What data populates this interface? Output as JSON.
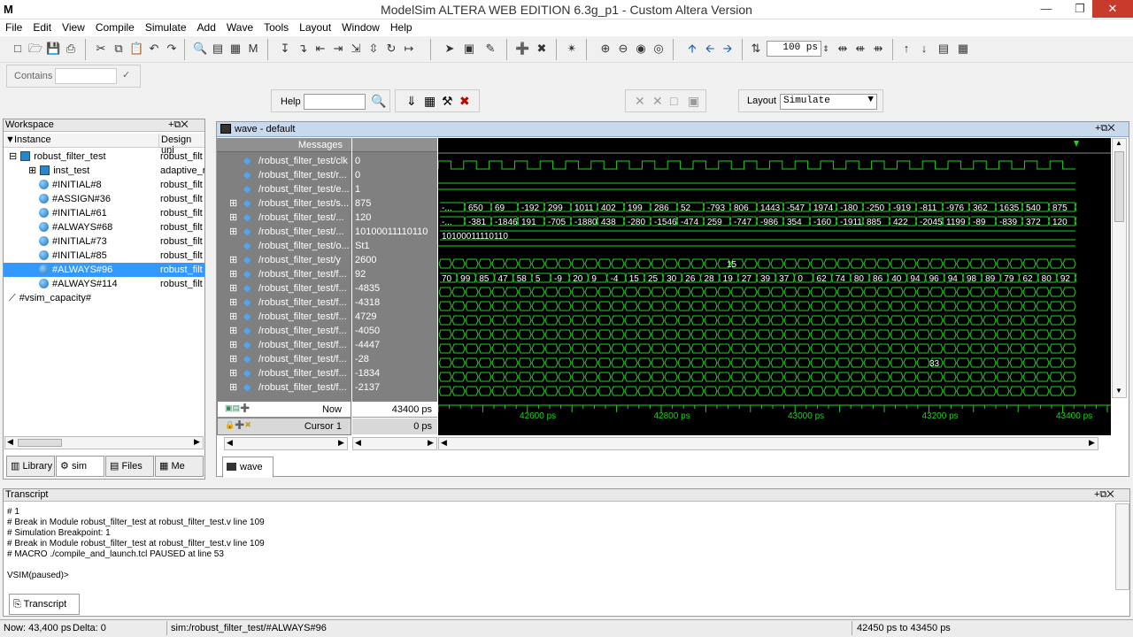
{
  "window": {
    "title": "ModelSim ALTERA WEB EDITION 6.3g_p1 - Custom Altera Version",
    "logo": "M"
  },
  "menu": [
    "File",
    "Edit",
    "View",
    "Compile",
    "Simulate",
    "Add",
    "Wave",
    "Tools",
    "Layout",
    "Window",
    "Help"
  ],
  "toolbar": {
    "zoom_value": "100 ps",
    "contains_label": "Contains",
    "help_label": "Help",
    "layout_label": "Layout",
    "layout_value": "Simulate"
  },
  "workspace": {
    "title": "Workspace",
    "col_instance": "Instance",
    "col_design": "Design uni",
    "rows": [
      {
        "name": "robust_filter_test",
        "design": "robust_filt",
        "icon": "cube-icon",
        "indent": 0,
        "expander": "-"
      },
      {
        "name": "inst_test",
        "design": "adaptive_r",
        "icon": "cube-icon",
        "indent": 1,
        "expander": "+"
      },
      {
        "name": "#INITIAL#8",
        "design": "robust_filt",
        "icon": "process-icon",
        "indent": 1,
        "expander": ""
      },
      {
        "name": "#ASSIGN#36",
        "design": "robust_filt",
        "icon": "process-icon",
        "indent": 1,
        "expander": ""
      },
      {
        "name": "#INITIAL#61",
        "design": "robust_filt",
        "icon": "process-icon",
        "indent": 1,
        "expander": ""
      },
      {
        "name": "#ALWAYS#68",
        "design": "robust_filt",
        "icon": "process-icon",
        "indent": 1,
        "expander": ""
      },
      {
        "name": "#INITIAL#73",
        "design": "robust_filt",
        "icon": "process-icon",
        "indent": 1,
        "expander": ""
      },
      {
        "name": "#INITIAL#85",
        "design": "robust_filt",
        "icon": "process-icon",
        "indent": 1,
        "expander": ""
      },
      {
        "name": "#ALWAYS#96",
        "design": "robust_filt",
        "icon": "process-icon",
        "indent": 1,
        "expander": "",
        "selected": true
      },
      {
        "name": "#ALWAYS#114",
        "design": "robust_filt",
        "icon": "process-icon",
        "indent": 1,
        "expander": ""
      },
      {
        "name": "#vsim_capacity#",
        "design": "",
        "icon": "capacity-icon",
        "indent": 0,
        "expander": ""
      }
    ],
    "tabs": [
      "Library",
      "sim",
      "Files",
      "Me"
    ]
  },
  "wave": {
    "title": "wave - default",
    "messages_label": "Messages",
    "signals": [
      {
        "name": "/robust_filter_test/clk",
        "value": "0",
        "exp": false
      },
      {
        "name": "/robust_filter_test/r...",
        "value": "0",
        "exp": false
      },
      {
        "name": "/robust_filter_test/e...",
        "value": "1",
        "exp": false
      },
      {
        "name": "/robust_filter_test/s...",
        "value": "875",
        "exp": true
      },
      {
        "name": "/robust_filter_test/...",
        "value": "120",
        "exp": true
      },
      {
        "name": "/robust_filter_test/...",
        "value": "10100011110110",
        "exp": true
      },
      {
        "name": "/robust_filter_test/o...",
        "value": "St1",
        "exp": false
      },
      {
        "name": "/robust_filter_test/y",
        "value": "2600",
        "exp": true
      },
      {
        "name": "/robust_filter_test/f...",
        "value": "92",
        "exp": true
      },
      {
        "name": "/robust_filter_test/f...",
        "value": "-4835",
        "exp": true
      },
      {
        "name": "/robust_filter_test/f...",
        "value": "-4318",
        "exp": true
      },
      {
        "name": "/robust_filter_test/f...",
        "value": "4729",
        "exp": true
      },
      {
        "name": "/robust_filter_test/f...",
        "value": "-4050",
        "exp": true
      },
      {
        "name": "/robust_filter_test/f...",
        "value": "-4447",
        "exp": true
      },
      {
        "name": "/robust_filter_test/f...",
        "value": "-28",
        "exp": true
      },
      {
        "name": "/robust_filter_test/f...",
        "value": "-1834",
        "exp": true
      },
      {
        "name": "/robust_filter_test/f...",
        "value": "-2137",
        "exp": true
      }
    ],
    "bus_row3": [
      "-...",
      "650",
      "69",
      "-192",
      "299",
      "1011",
      "402",
      "199",
      "286",
      "52",
      "-793",
      "806",
      "1443",
      "-547",
      "1974",
      "-180",
      "-250",
      "-919",
      "-811",
      "-976",
      "362",
      "1635",
      "540",
      "875"
    ],
    "bus_row4": [
      "-...",
      "-381",
      "-1846",
      "191",
      "-705",
      "-1880",
      "438",
      "-280",
      "-1546",
      "-474",
      "259",
      "-747",
      "-986",
      "354",
      "-160",
      "-1911",
      "885",
      "422",
      "-2045",
      "1199",
      "-89",
      "-839",
      "372",
      "120"
    ],
    "bus_row5": "10100011110110",
    "row8_label": "15",
    "row9": [
      "70",
      "99",
      "85",
      "47",
      "58",
      "5",
      "-9",
      "20",
      "9",
      "-4",
      "15",
      "25",
      "30",
      "26",
      "28",
      "19",
      "27",
      "39",
      "37",
      "0",
      "62",
      "74",
      "80",
      "86",
      "40",
      "94",
      "96",
      "94",
      "98",
      "89",
      "79",
      "62",
      "80",
      "92"
    ],
    "row15_label": "33",
    "now_label": "Now",
    "now_value": "43400 ps",
    "cursor_label": "Cursor 1",
    "cursor_value": "0 ps",
    "time_ticks": [
      "42600 ps",
      "42800 ps",
      "43000 ps",
      "43200 ps",
      "43400 ps"
    ],
    "tab": "wave"
  },
  "transcript": {
    "title": "Transcript",
    "lines": [
      "# 1",
      "# Break in Module robust_filter_test at robust_filter_test.v line 109",
      "# Simulation Breakpoint: 1",
      "# Break in Module robust_filter_test at robust_filter_test.v line 109",
      "# MACRO ./compile_and_launch.tcl PAUSED at line 53"
    ],
    "prompt": "VSIM(paused)>",
    "tab": "Transcript"
  },
  "status": {
    "now": "Now: 43,400 ps",
    "delta": "Delta: 0",
    "context": "sim:/robust_filter_test/#ALWAYS#96",
    "range": "42450 ps to 43450 ps"
  }
}
